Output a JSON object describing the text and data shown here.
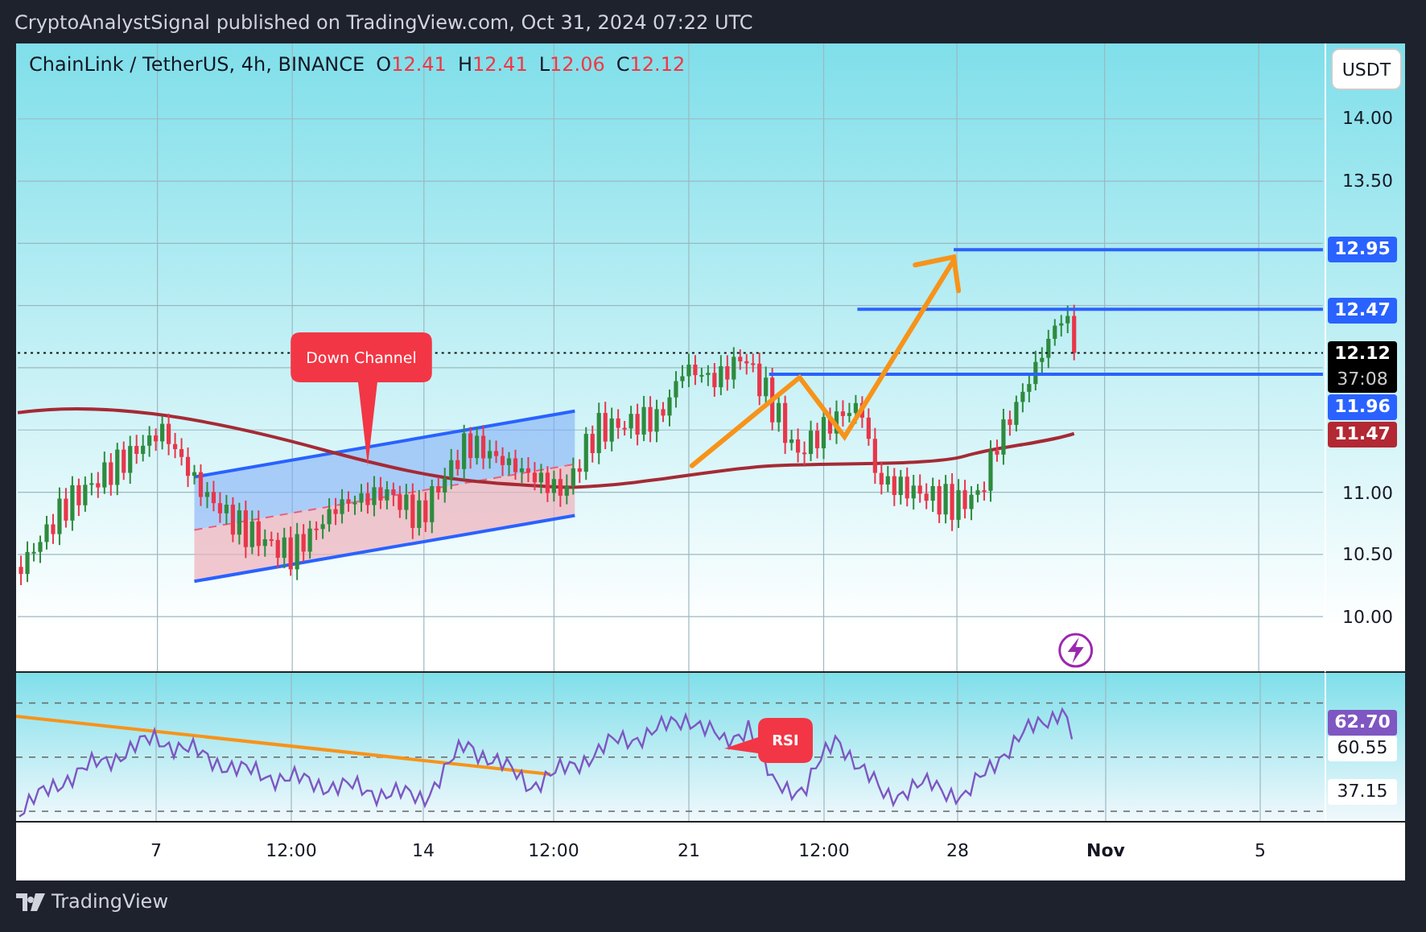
{
  "header": {
    "publisher_line": "CryptoAnalystSignal published on TradingView.com, Oct 31, 2024 07:22 UTC"
  },
  "legend": {
    "symbol": "ChainLink / TetherUS, 4h, BINANCE",
    "ohlc": [
      {
        "label": "O",
        "value": "12.41"
      },
      {
        "label": "H",
        "value": "12.41"
      },
      {
        "label": "L",
        "value": "12.06"
      },
      {
        "label": "C",
        "value": "12.12"
      }
    ]
  },
  "currency_button": "USDT",
  "price_axis": {
    "ticks": [
      "14.00",
      "13.50",
      "11.00",
      "10.50",
      "10.00"
    ]
  },
  "price_tags": [
    {
      "value": "12.95",
      "kind": "level"
    },
    {
      "value": "12.47",
      "kind": "level"
    },
    {
      "value": "12.12",
      "countdown": "37:08",
      "kind": "last"
    },
    {
      "value": "11.96",
      "kind": "level"
    },
    {
      "value": "11.47",
      "kind": "ma"
    }
  ],
  "callouts": [
    {
      "text": "Down Channel"
    }
  ],
  "rsi": {
    "callout": "RSI",
    "tags": [
      {
        "value": "62.70",
        "kind": "rsi"
      },
      {
        "value": "60.55",
        "kind": "plain"
      },
      {
        "value": "37.15",
        "kind": "plain"
      }
    ]
  },
  "time_axis": [
    {
      "label": "7",
      "bold": false
    },
    {
      "label": "12:00",
      "bold": false
    },
    {
      "label": "14",
      "bold": false
    },
    {
      "label": "12:00",
      "bold": false
    },
    {
      "label": "21",
      "bold": false
    },
    {
      "label": "12:00",
      "bold": false
    },
    {
      "label": "28",
      "bold": false
    },
    {
      "label": "Nov",
      "bold": true
    },
    {
      "label": "5",
      "bold": false
    }
  ],
  "footer": {
    "brand": "TradingView"
  }
}
